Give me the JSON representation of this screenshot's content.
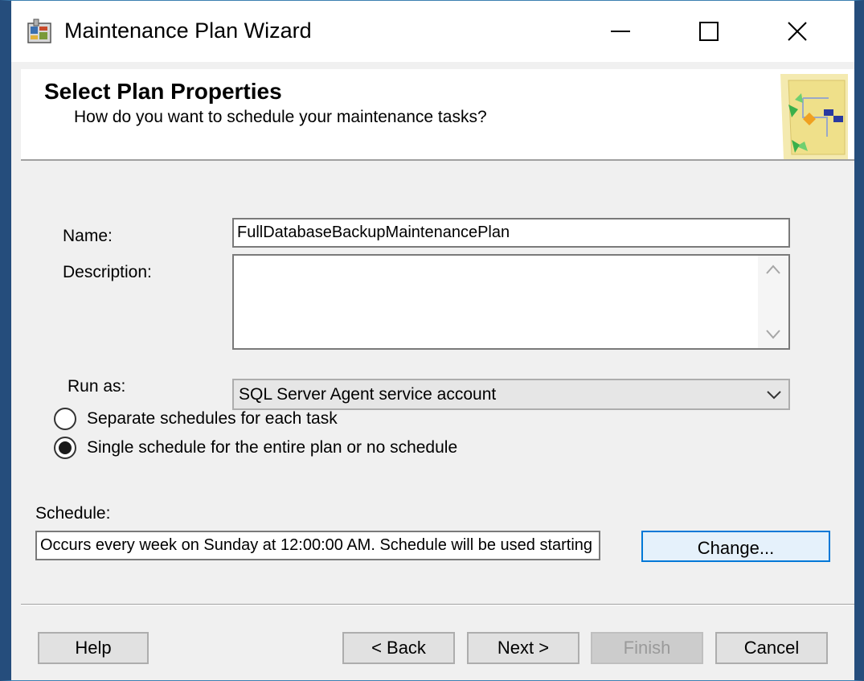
{
  "window": {
    "title": "Maintenance Plan Wizard",
    "icon": "wizard-app-icon"
  },
  "controls": {
    "minimize_icon": "minimize-icon",
    "maximize_icon": "maximize-icon",
    "close_icon": "close-icon"
  },
  "banner": {
    "title": "Select Plan Properties",
    "subtitle": "How do you want to schedule your maintenance tasks?",
    "art_icon": "wizard-banner-graphic"
  },
  "form": {
    "name_label": "Name:",
    "name_value": "FullDatabaseBackupMaintenancePlan",
    "description_label": "Description:",
    "description_value": "",
    "run_as_label": "Run as:",
    "run_as_value": "SQL Server Agent service account",
    "radio_separate_label": "Separate schedules for each task",
    "radio_single_label": "Single schedule for the entire plan or no schedule",
    "selected_radio": "single",
    "schedule_label": "Schedule:",
    "schedule_value": "Occurs every week on Sunday at 12:00:00 AM. Schedule will be used starting",
    "change_button": "Change..."
  },
  "footer": {
    "help": "Help",
    "back": "< Back",
    "next": "Next >",
    "finish": "Finish",
    "cancel": "Cancel"
  },
  "colors": {
    "window_border": "#254d7c",
    "focus_accent": "#0078d7"
  }
}
